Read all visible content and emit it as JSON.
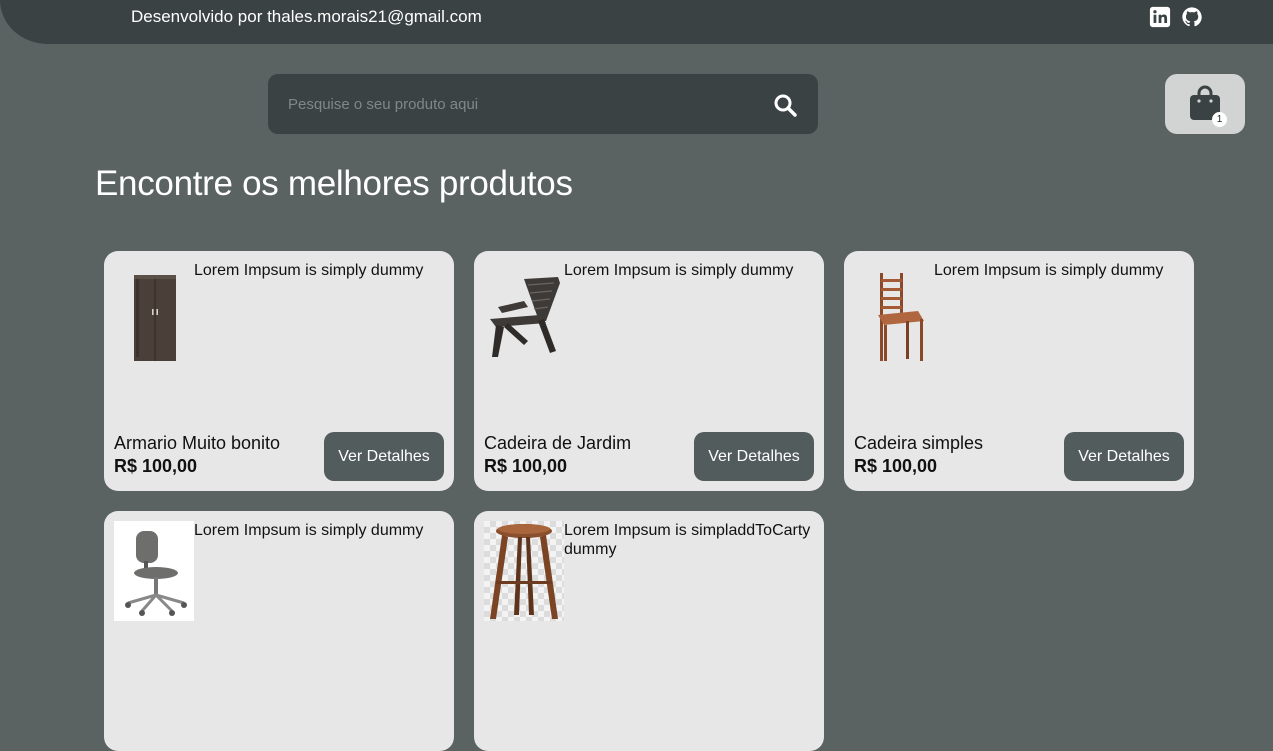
{
  "header": {
    "developer_text": "Desenvolvido por thales.morais21@gmail.com",
    "linkedin_icon": "linkedin-icon",
    "github_icon": "github-icon"
  },
  "search": {
    "placeholder": "Pesquise o seu produto aqui",
    "value": "",
    "icon": "search-icon"
  },
  "cart": {
    "icon": "shopping-bag-icon",
    "count": "1"
  },
  "main": {
    "title": "Encontre os melhores produtos"
  },
  "products": [
    {
      "description": "Lorem Impsum is simply dummy",
      "name": "Armario Muito bonito",
      "price": "R$ 100,00",
      "button_label": "Ver Detalhes",
      "image": "wardrobe"
    },
    {
      "description": "Lorem Impsum is simply dummy",
      "name": "Cadeira de Jardim",
      "price": "R$ 100,00",
      "button_label": "Ver Detalhes",
      "image": "garden-chair"
    },
    {
      "description": "Lorem Impsum is simply dummy",
      "name": "Cadeira simples",
      "price": "R$ 100,00",
      "button_label": "Ver Detalhes",
      "image": "wooden-chair"
    },
    {
      "description": "Lorem Impsum is simply dummy",
      "image": "office-chair"
    },
    {
      "description": "Lorem Impsum is simpladdToCarty dummy",
      "image": "wooden-stool"
    }
  ],
  "colors": {
    "page_background": "#5a6262",
    "topbar_background": "#3b4243",
    "card_background": "#e7e7e7",
    "button_background": "#535c5c",
    "cart_button_background": "#d2d4d4"
  }
}
